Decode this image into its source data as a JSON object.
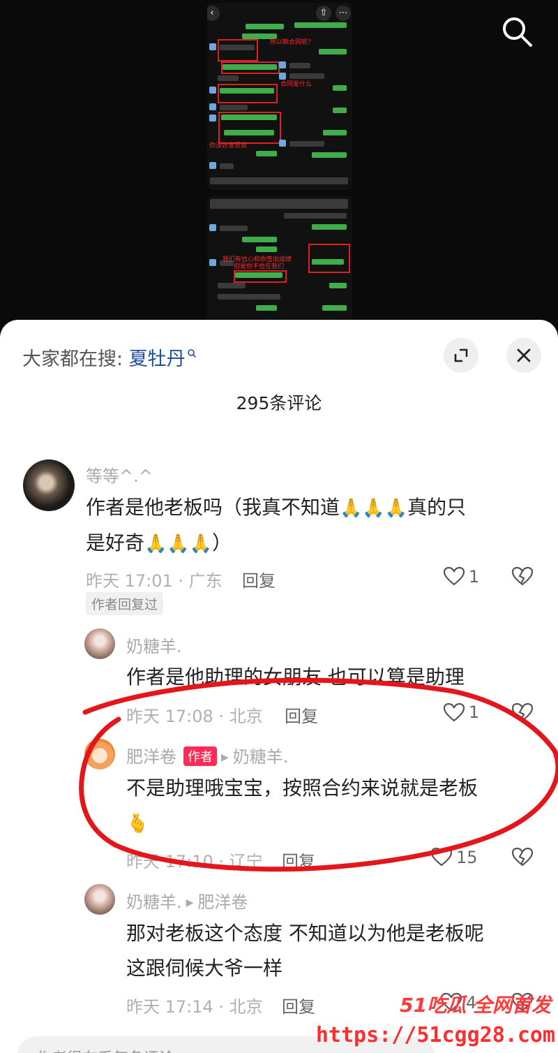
{
  "media": {
    "annotations": [
      "所以新合同呢？",
      "合同是什么",
      "你没好意思说",
      "我们有信心和你签出成绩",
      "但是你不信任我们"
    ]
  },
  "sheet": {
    "search_prefix": "大家都在搜: ",
    "search_keyword": "夏牡丹",
    "comment_count": "295条评论",
    "input_placeholder": "作者很在乎每条评论"
  },
  "comments": [
    {
      "user": "等等^.^",
      "text_lines": [
        "作者是他老板吗（我真不知道",
        "真的只",
        "是好奇",
        "）"
      ],
      "time_loc": "昨天 17:01 · 广东",
      "reply_label": "回复",
      "likes": "1",
      "author_replied_tag": "作者回复过"
    },
    {
      "user": "奶糖羊.",
      "text": "作者是他助理的女朋友 也可以算是助理",
      "time_loc": "昨天 17:08 · 北京",
      "reply_label": "回复",
      "likes": "1"
    },
    {
      "user": "肥洋卷",
      "badge": "作者",
      "reply_to": "奶糖羊.",
      "text": "不是助理哦宝宝，按照合约来说就是老板",
      "time_loc": "昨天 17:10 · 辽宁",
      "reply_label": "回复",
      "likes": "15"
    },
    {
      "user": "奶糖羊.",
      "reply_to": "肥洋卷",
      "text_line1": "那对老板这个态度 不知道以为他是老板呢",
      "text_line2": "这跟伺候大爷一样",
      "time_loc": "昨天 17:14 · 北京",
      "reply_label": "回复",
      "likes": "4"
    }
  ],
  "watermark": {
    "logo": "51吃瓜 全网首发",
    "url": "https://51cgg28.com"
  },
  "colors": {
    "accent": "#fe2c55",
    "keyword": "#1f4f9b",
    "ink_circle": "#e3161b"
  },
  "icons": [
    "search-icon",
    "expand-icon",
    "close-icon",
    "heart-icon",
    "broken-heart-icon",
    "pray-emoji",
    "finger-heart-emoji"
  ]
}
